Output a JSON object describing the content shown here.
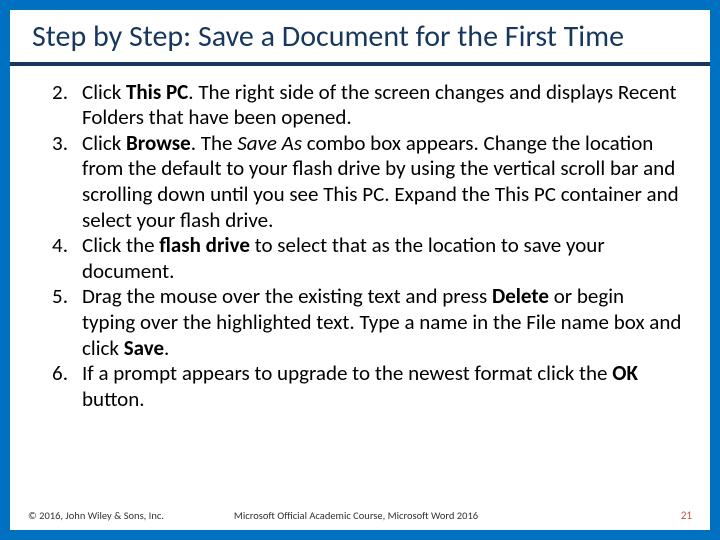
{
  "title": "Step by Step: Save a Document for the First Time",
  "steps": [
    {
      "n": "2.",
      "html": "Click <b>This PC</b>. The right side of the screen changes and displays Recent Folders that have been opened."
    },
    {
      "n": "3.",
      "html": "Click <b>Browse</b>. The <i>Save As</i> combo box appears. Change the location from the default to your flash drive by using the vertical scroll bar and scrolling down until you see This PC. Expand the This PC container and select your flash drive."
    },
    {
      "n": "4.",
      "html": "Click the <b>flash drive</b> to select that as the location to save your document."
    },
    {
      "n": "5.",
      "html": "Drag the mouse over the existing text and press <b>Delete</b> or begin typing over the highlighted text. Type a name in the File name box and click <b>Save</b>."
    },
    {
      "n": "6.",
      "html": "If a prompt appears to upgrade to the newest format click the <b>OK</b> button."
    }
  ],
  "footer": {
    "copyright": "© 2016, John Wiley & Sons, Inc.",
    "course": "Microsoft Official Academic Course, Microsoft Word 2016",
    "pagenum": "21"
  }
}
